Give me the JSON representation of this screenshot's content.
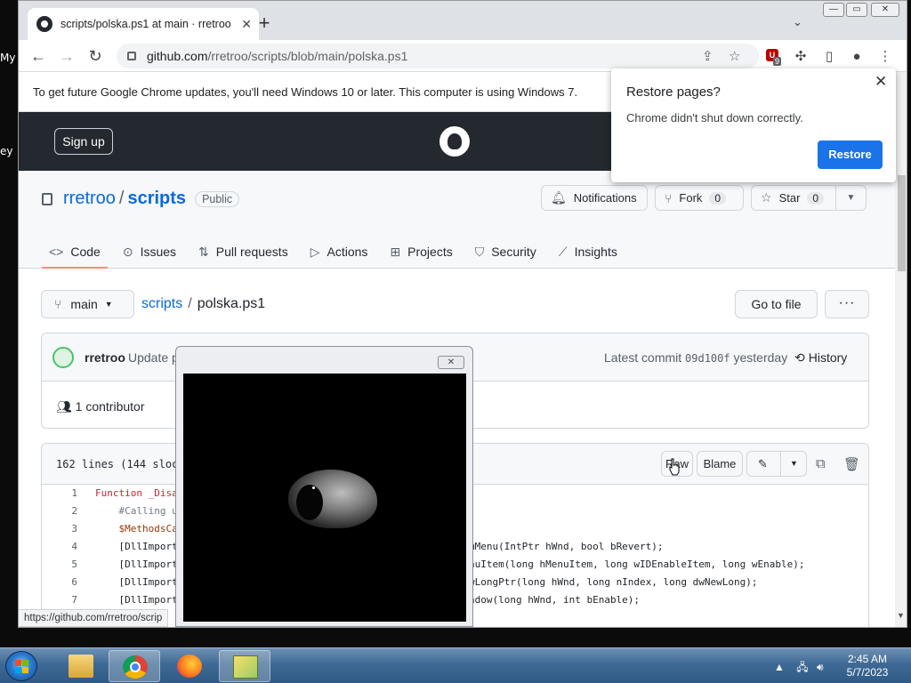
{
  "desktop": {
    "fragment_1": "My",
    "fragment_2": "ey"
  },
  "browser": {
    "tab_title": "scripts/polska.ps1 at main · rretroo",
    "new_tab": "+",
    "url_host": "github.com",
    "url_path": "/rretroo/scripts/blob/main/polska.ps1",
    "extension_badge": "9"
  },
  "infobar": {
    "message": "To get future Google Chrome updates, you'll need Windows 10 or later. This computer is using Windows 7."
  },
  "restore": {
    "title": "Restore pages?",
    "message": "Chrome didn't shut down correctly.",
    "button": "Restore"
  },
  "github": {
    "signup": "Sign up"
  },
  "repo": {
    "owner": "rretroo",
    "separator": "/",
    "name": "scripts",
    "visibility": "Public",
    "notifications": "Notifications",
    "fork_label": "Fork",
    "fork_count": "0",
    "star_label": "Star",
    "star_count": "0",
    "nav": [
      {
        "label": "Code"
      },
      {
        "label": "Issues"
      },
      {
        "label": "Pull requests"
      },
      {
        "label": "Actions"
      },
      {
        "label": "Projects"
      },
      {
        "label": "Security"
      },
      {
        "label": "Insights"
      }
    ]
  },
  "path": {
    "branch": "main",
    "folder": "scripts",
    "separator": "/",
    "file": "polska.ps1",
    "goto_file": "Go to file",
    "more": "···"
  },
  "commit": {
    "author": "rretroo",
    "message": "Update p",
    "latest_label": "Latest commit",
    "sha": "09d100f",
    "when": "yesterday",
    "history": "History",
    "contributors": "1 contributor"
  },
  "file": {
    "meta": "162 lines (144 sloc)",
    "raw": "Raw",
    "blame": "Blame",
    "lines": [
      {
        "n": "1",
        "left": "Function _Disa",
        "right": ""
      },
      {
        "n": "2",
        "left": "    #Calling u",
        "right": ""
      },
      {
        "n": "3",
        "left": "    $MethodsCa",
        "right": ""
      },
      {
        "n": "4",
        "left": "    [DllImport",
        "right": "mMenu(IntPtr hWnd, bool bRevert);"
      },
      {
        "n": "5",
        "left": "    [DllImport",
        "right": "nuItem(long hMenuItem, long wIDEnableItem, long wEnable);"
      },
      {
        "n": "6",
        "left": "    [DllImport",
        "right": "wLongPtr(long hWnd, long nIndex, long dwNewLong);"
      },
      {
        "n": "7",
        "left": "    [DllImport",
        "right": "ndow(long hWnd, int bEnable);"
      }
    ]
  },
  "status_bar": {
    "url": "https://github.com/rretroo/scrip"
  },
  "taskbar": {
    "time": "2:45 AM",
    "date": "5/7/2023"
  }
}
